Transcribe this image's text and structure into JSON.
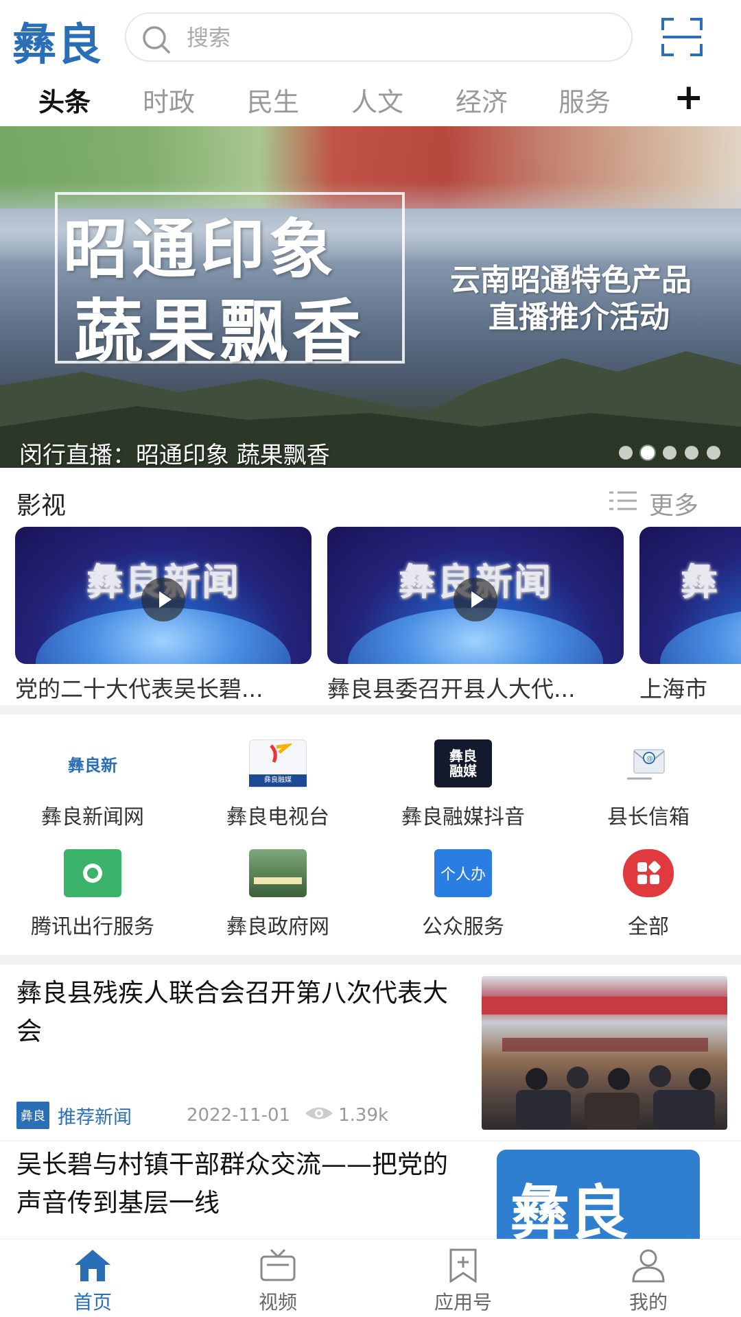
{
  "header": {
    "logo_text": "彝良",
    "search_placeholder": "搜索",
    "scan_icon": "scan-icon"
  },
  "tabs": [
    {
      "label": "头条",
      "active": true
    },
    {
      "label": "时政"
    },
    {
      "label": "民生"
    },
    {
      "label": "人文"
    },
    {
      "label": "经济"
    },
    {
      "label": "服务"
    }
  ],
  "tab_add_label": "+",
  "banner": {
    "calligraphy_line1": "昭通印象",
    "calligraphy_line2": "蔬果飘香",
    "subtitle_line1": "云南昭通特色产品",
    "subtitle_line2": "直播推介活动",
    "caption": "闵行直播：昭通印象 蔬果飘香",
    "dots_total": 5,
    "dots_active_index": 1
  },
  "video_section": {
    "title": "影视",
    "more_label": "更多",
    "items": [
      {
        "thumb_text": "彝良新闻",
        "caption": "党的二十大代表吴长碧..."
      },
      {
        "thumb_text": "彝良新闻",
        "caption": "彝良县委召开县人大代..."
      },
      {
        "thumb_text": "彝",
        "caption": "上海市"
      }
    ]
  },
  "apps": [
    {
      "label": "彝良新闻网",
      "icon": "yiliang-news-logo",
      "icon_text": "彝良新"
    },
    {
      "label": "彝良电视台",
      "icon": "tv-station-logo",
      "icon_text": "彝良融媒"
    },
    {
      "label": "彝良融媒抖音",
      "icon": "douyin-logo",
      "icon_text": "彝良融媒"
    },
    {
      "label": "县长信箱",
      "icon": "mailbox-icon",
      "icon_text": ""
    },
    {
      "label": "腾讯出行服务",
      "icon": "tencent-travel-logo",
      "icon_text": ""
    },
    {
      "label": "彝良政府网",
      "icon": "government-site-logo",
      "icon_text": ""
    },
    {
      "label": "公众服务",
      "icon": "public-service-logo",
      "icon_text": "个人办"
    },
    {
      "label": "全部",
      "icon": "all-apps-icon",
      "icon_text": ""
    }
  ],
  "news": [
    {
      "title": "彝良县残疾人联合会召开第八次代表大会",
      "source_logo": "彝良",
      "source": "推荐新闻",
      "date": "2022-11-01",
      "views": "1.39k"
    },
    {
      "title": "吴长碧与村镇干部群众交流——把党的声音传到基层一线",
      "thumb_text": "彝良"
    }
  ],
  "bottom_nav": [
    {
      "label": "首页",
      "icon": "home-icon",
      "active": true
    },
    {
      "label": "视频",
      "icon": "tv-icon"
    },
    {
      "label": "应用号",
      "icon": "bookmark-icon"
    },
    {
      "label": "我的",
      "icon": "user-icon"
    }
  ],
  "colors": {
    "brand_blue": "#2a6fb5",
    "divider": "#f1f2f4",
    "inactive_text": "#999999"
  }
}
